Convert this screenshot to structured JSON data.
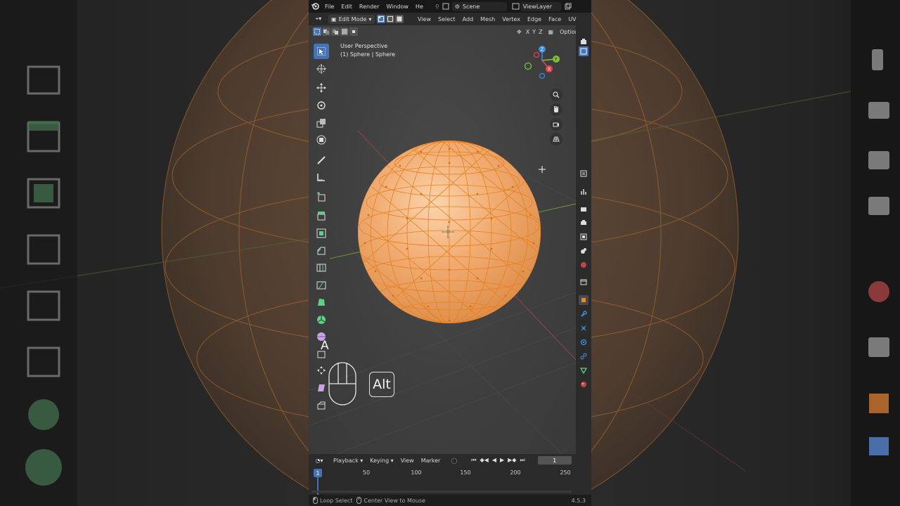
{
  "topbar": {
    "menus": [
      "File",
      "Edit",
      "Render",
      "Window",
      "He"
    ],
    "scene_label": "Scene",
    "viewlayer_label": "ViewLayer"
  },
  "header": {
    "mode": "Edit Mode",
    "menus": [
      "View",
      "Select",
      "Add",
      "Mesh",
      "Vertex",
      "Edge",
      "Face",
      "UV"
    ],
    "axes": [
      "X",
      "Y",
      "Z"
    ],
    "options_label": "Options"
  },
  "viewport": {
    "perspective": "User Perspective",
    "object_info": "(1) Sphere | Sphere"
  },
  "overlay_keys": {
    "key_a": "A",
    "key_alt": "Alt"
  },
  "timeline": {
    "menus": [
      "Playback",
      "Keying",
      "View",
      "Marker"
    ],
    "current_frame": "1",
    "ticks": [
      "1",
      "50",
      "100",
      "150",
      "200",
      "250"
    ]
  },
  "statusbar": {
    "left_hint": "Loop Select",
    "mid_hint": "Center View to Mouse",
    "version": "4.5.3"
  },
  "colors": {
    "accent": "#4772b3",
    "mesh_orange": "#f29a4a",
    "wire_orange": "#e8821f",
    "x_axis": "#e8424e",
    "y_axis": "#7ec43a",
    "z_axis": "#3b8ce6"
  }
}
